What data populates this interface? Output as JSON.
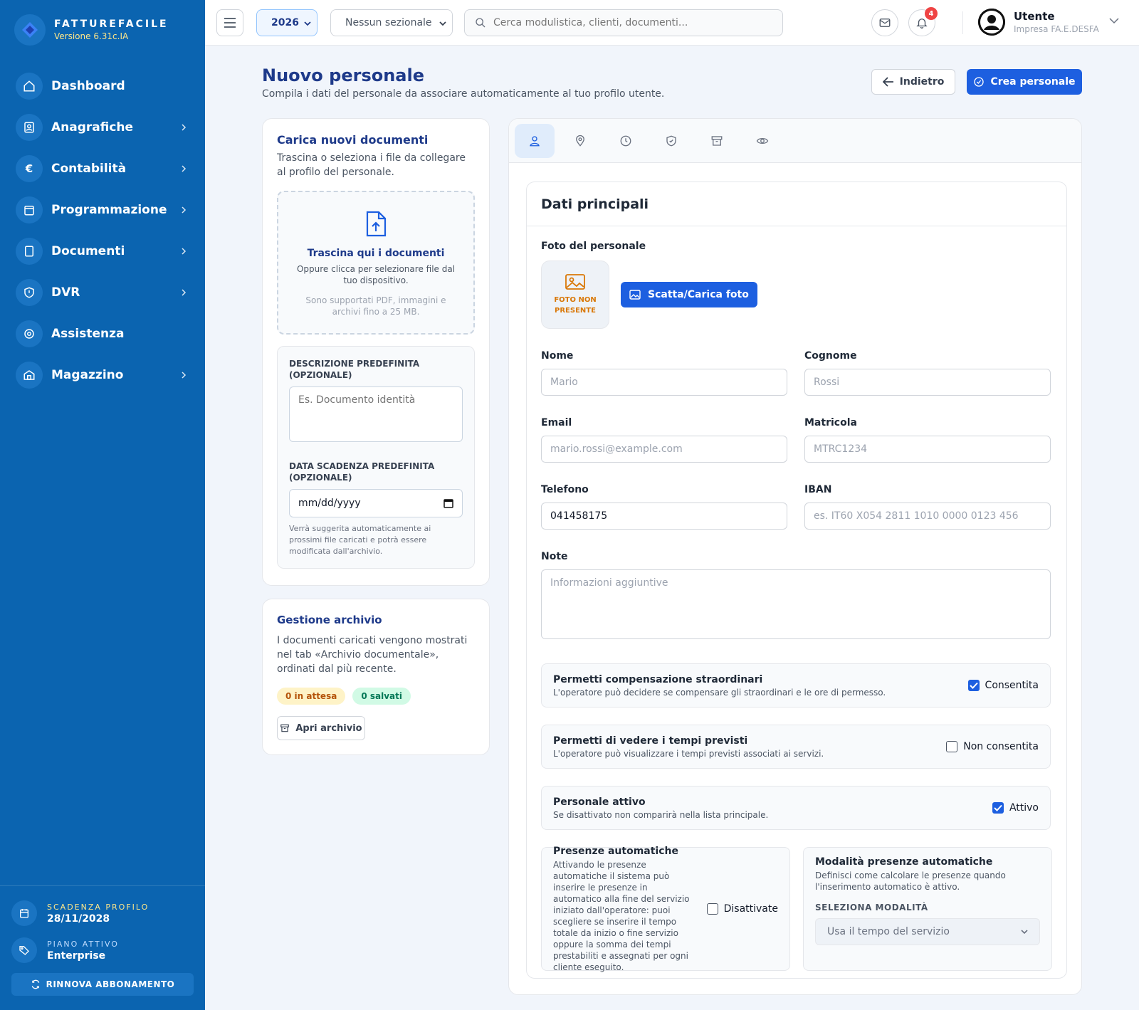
{
  "app": {
    "brand_name": "FATTUREFACILE",
    "version": "Versione 6.31c.IA"
  },
  "sidebar": {
    "items": [
      {
        "label": "Dashboard",
        "icon": "home-icon",
        "has_chevron": false
      },
      {
        "label": "Anagrafiche",
        "icon": "contacts-icon",
        "has_chevron": true
      },
      {
        "label": "Contabilità",
        "icon": "euro-icon",
        "has_chevron": true
      },
      {
        "label": "Programmazione",
        "icon": "calendar-icon",
        "has_chevron": true
      },
      {
        "label": "Documenti",
        "icon": "document-icon",
        "has_chevron": true
      },
      {
        "label": "DVR",
        "icon": "shield-icon",
        "has_chevron": true
      },
      {
        "label": "Assistenza",
        "icon": "lifebuoy-icon",
        "has_chevron": false
      },
      {
        "label": "Magazzino",
        "icon": "warehouse-icon",
        "has_chevron": true
      }
    ],
    "footer": {
      "expiry_label": "SCADENZA PROFILO",
      "expiry_value": "28/11/2028",
      "plan_label": "PIANO ATTIVO",
      "plan_value": "Enterprise",
      "renew_label": "RINNOVA ABBONAMENTO"
    }
  },
  "topbar": {
    "year": "2026",
    "sezionale": "Nessun sezionale",
    "search_placeholder": "Cerca modulistica, clienti, documenti...",
    "notifications_count": "4",
    "user_name": "Utente",
    "user_company": "Impresa FA.E.DESFA"
  },
  "page": {
    "title": "Nuovo personale",
    "subtitle": "Compila i dati del personale da associare automaticamente al tuo profilo utente.",
    "back_label": "Indietro",
    "create_label": "Crea personale"
  },
  "upload": {
    "title": "Carica nuovi documenti",
    "description": "Trascina o seleziona i file da collegare al profilo del personale.",
    "drop_title": "Trascina qui i documenti",
    "drop_desc": "Oppure clicca per selezionare file dal tuo dispositivo.",
    "drop_note": "Sono supportati PDF, immagini e archivi fino a 25 MB.",
    "desc_label": "DESCRIZIONE PREDEFINITA (OPZIONALE)",
    "desc_placeholder": "Es. Documento identità",
    "date_label": "DATA SCADENZA PREDEFINITA (OPZIONALE)",
    "date_placeholder": "mm/dd/yyyy",
    "date_note": "Verrà suggerita automaticamente ai prossimi file caricati e potrà essere modificata dall'archivio."
  },
  "archive": {
    "title": "Gestione archivio",
    "description": "I documenti caricati vengono mostrati nel tab «Archivio documentale», ordinati dal più recente.",
    "pending": "0 in attesa",
    "saved": "0 salvati",
    "open_label": "Apri archivio"
  },
  "tabs": [
    "user-icon",
    "location-pin-icon",
    "clock-icon",
    "shield-check-icon",
    "archive-box-icon",
    "eye-icon"
  ],
  "form": {
    "section_title": "Dati principali",
    "photo_label": "Foto del personale",
    "photo_missing": "FOTO NON PRESENTE",
    "photo_button": "Scatta/Carica foto",
    "fields": {
      "nome": {
        "label": "Nome",
        "placeholder": "Mario",
        "value": ""
      },
      "cognome": {
        "label": "Cognome",
        "placeholder": "Rossi",
        "value": ""
      },
      "email": {
        "label": "Email",
        "placeholder": "mario.rossi@example.com",
        "value": ""
      },
      "matricola": {
        "label": "Matricola",
        "placeholder": "MTRC1234",
        "value": ""
      },
      "telefono": {
        "label": "Telefono",
        "placeholder": "",
        "value": "041458175"
      },
      "iban": {
        "label": "IBAN",
        "placeholder": "es. IT60 X054 2811 1010 0000 0123 456",
        "value": ""
      },
      "note": {
        "label": "Note",
        "placeholder": "Informazioni aggiuntive",
        "value": ""
      }
    },
    "toggles": {
      "compensazione": {
        "title": "Permetti compensazione straordinari",
        "desc": "L'operatore può decidere se compensare gli straordinari e le ore di permesso.",
        "label": "Consentita",
        "checked": true
      },
      "tempi": {
        "title": "Permetti di vedere i tempi previsti",
        "desc": "L'operatore può visualizzare i tempi previsti associati ai servizi.",
        "label": "Non consentita",
        "checked": false
      },
      "attivo": {
        "title": "Personale attivo",
        "desc": "Se disattivato non comparirà nella lista principale.",
        "label": "Attivo",
        "checked": true
      }
    },
    "auto": {
      "title": "Presenze automatiche",
      "desc": "Attivando le presenze automatiche il sistema può inserire le presenze in automatico alla fine del servizio iniziato dall'operatore: puoi scegliere se inserire il tempo totale da inizio o fine servizio oppure la somma dei tempi prestabiliti e assegnati per ogni cliente eseguito.",
      "label": "Disattivate",
      "checked": false
    },
    "mode": {
      "title": "Modalità presenze automatiche",
      "desc": "Definisci come calcolare le presenze quando l'inserimento automatico è attivo.",
      "select_label": "SELEZIONA MODALITÀ",
      "selected": "Usa il tempo del servizio"
    }
  },
  "colors": {
    "sidebar": "#0b64b0",
    "primary": "#1d5fe0",
    "title": "#1e3a8a",
    "accent_yellow": "#fde68a"
  }
}
